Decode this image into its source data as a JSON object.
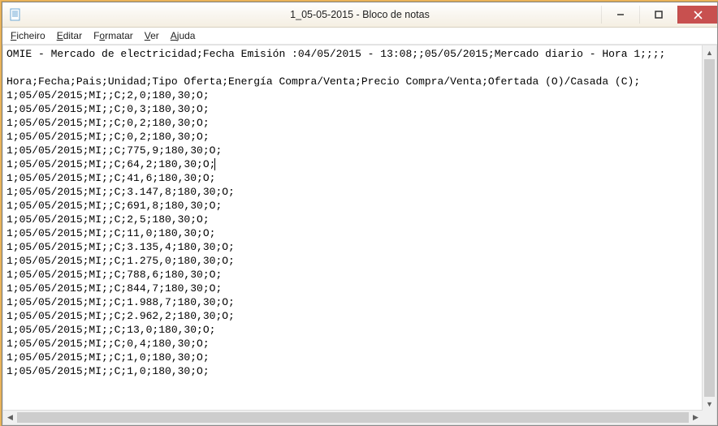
{
  "window": {
    "title": "1_05-05-2015 - Bloco de notas"
  },
  "menu": {
    "items": [
      {
        "accel": "F",
        "rest": "icheiro"
      },
      {
        "accel": "E",
        "rest": "ditar"
      },
      {
        "accel": "F",
        "rest": "ormatar",
        "pre": ""
      },
      {
        "accel": "V",
        "rest": "er"
      },
      {
        "accel": "A",
        "rest": "juda"
      }
    ],
    "item0": "Ficheiro",
    "item1": "Editar",
    "item2": "Formatar",
    "item3": "Ver",
    "item4": "Ajuda"
  },
  "document": {
    "header": "OMIE - Mercado de electricidad;Fecha Emisión :04/05/2015 - 13:08;;05/05/2015;Mercado diario - Hora 1;;;;",
    "blank": "",
    "columns": "Hora;Fecha;Pais;Unidad;Tipo Oferta;Energía Compra/Venta;Precio Compra/Venta;Ofertada (O)/Casada (C);",
    "rows": [
      "1;05/05/2015;MI;;C;2,0;180,30;O;",
      "1;05/05/2015;MI;;C;0,3;180,30;O;",
      "1;05/05/2015;MI;;C;0,2;180,30;O;",
      "1;05/05/2015;MI;;C;0,2;180,30;O;",
      "1;05/05/2015;MI;;C;775,9;180,30;O;",
      "1;05/05/2015;MI;;C;64,2;180,30;O;",
      "1;05/05/2015;MI;;C;41,6;180,30;O;",
      "1;05/05/2015;MI;;C;3.147,8;180,30;O;",
      "1;05/05/2015;MI;;C;691,8;180,30;O;",
      "1;05/05/2015;MI;;C;2,5;180,30;O;",
      "1;05/05/2015;MI;;C;11,0;180,30;O;",
      "1;05/05/2015;MI;;C;3.135,4;180,30;O;",
      "1;05/05/2015;MI;;C;1.275,0;180,30;O;",
      "1;05/05/2015;MI;;C;788,6;180,30;O;",
      "1;05/05/2015;MI;;C;844,7;180,30;O;",
      "1;05/05/2015;MI;;C;1.988,7;180,30;O;",
      "1;05/05/2015;MI;;C;2.962,2;180,30;O;",
      "1;05/05/2015;MI;;C;13,0;180,30;O;",
      "1;05/05/2015;MI;;C;0,4;180,30;O;",
      "1;05/05/2015;MI;;C;1,0;180,30;O;",
      "1;05/05/2015;MI;;C;1,0;180,30;O;"
    ],
    "caret_after_row_index": 5
  }
}
